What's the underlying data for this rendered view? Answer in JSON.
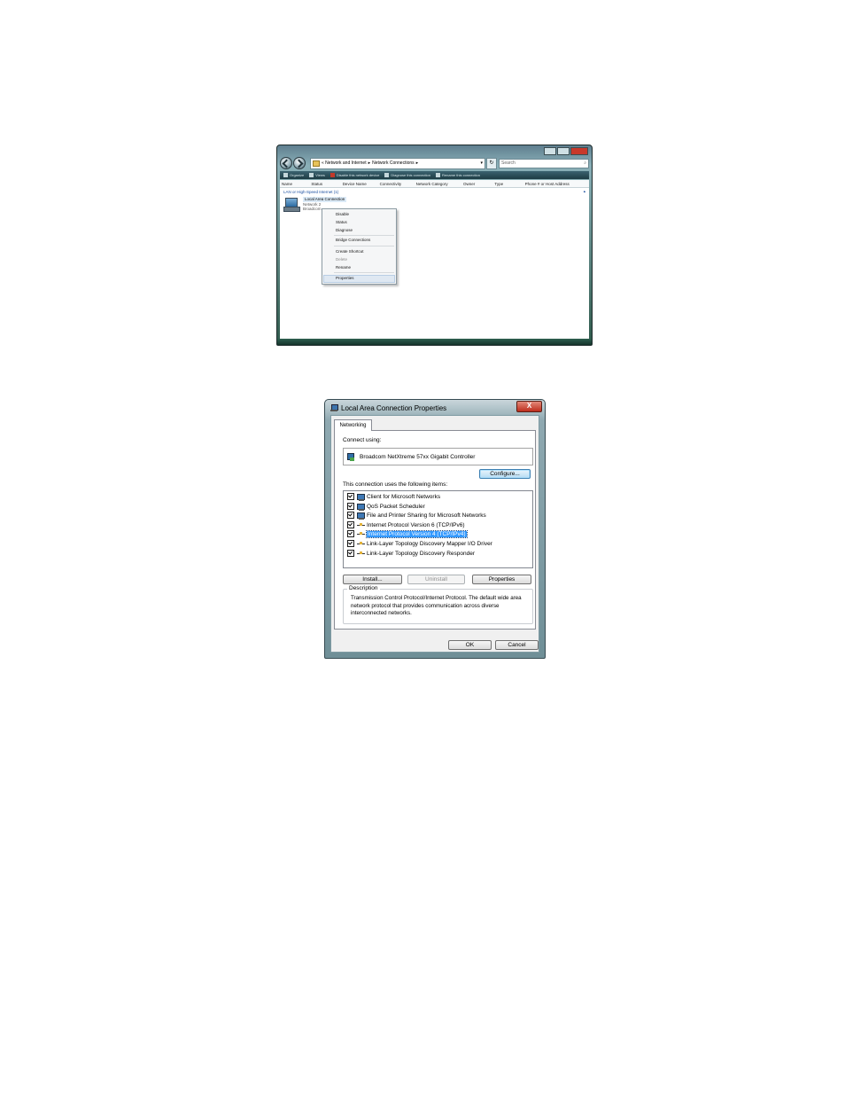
{
  "explorer": {
    "breadcrumb": [
      "Network and Internet",
      "Network Connections"
    ],
    "search_placeholder": "Search",
    "toolbar": [
      "Organize",
      "Views",
      "Disable this network device",
      "Diagnose this connection",
      "Rename this connection"
    ],
    "columns": [
      "Name",
      "Status",
      "Device Name",
      "Connectivity",
      "Network Category",
      "Owner",
      "Type",
      "Phone # or Host Address"
    ],
    "group_header": "LAN or High-Speed Internet (1)",
    "connection": {
      "name": "Local Area Connection",
      "status": "Network  2",
      "device": "Broadcom"
    },
    "context_menu": {
      "items": [
        {
          "label": "Disable",
          "disabled": false
        },
        {
          "label": "Status",
          "disabled": false
        },
        {
          "label": "Diagnose",
          "disabled": false
        },
        {
          "label": "Bridge Connections",
          "disabled": false
        },
        {
          "label": "Create Shortcut",
          "disabled": false
        },
        {
          "label": "Delete",
          "disabled": true
        },
        {
          "label": "Rename",
          "disabled": false
        },
        {
          "label": "Properties",
          "disabled": false
        }
      ]
    }
  },
  "dialog": {
    "title": "Local Area Connection Properties",
    "close_label": "X",
    "tab": "Networking",
    "connect_using_label": "Connect using:",
    "adapter": "Broadcom NetXtreme 57xx Gigabit Controller",
    "configure_button": "Configure...",
    "items_label": "This connection uses the following items:",
    "items": [
      {
        "label": "Client for Microsoft Networks",
        "checked": true,
        "icon": "network-client-icon"
      },
      {
        "label": "QoS Packet Scheduler",
        "checked": true,
        "icon": "network-client-icon"
      },
      {
        "label": "File and Printer Sharing for Microsoft Networks",
        "checked": true,
        "icon": "network-client-icon"
      },
      {
        "label": "Internet Protocol Version 6 (TCP/IPv6)",
        "checked": true,
        "icon": "protocol-icon"
      },
      {
        "label": "Internet Protocol Version 4 (TCP/IPv4)",
        "checked": true,
        "icon": "protocol-icon",
        "selected": true
      },
      {
        "label": "Link-Layer Topology Discovery Mapper I/O Driver",
        "checked": true,
        "icon": "protocol-icon"
      },
      {
        "label": "Link-Layer Topology Discovery Responder",
        "checked": true,
        "icon": "protocol-icon"
      }
    ],
    "install_button": "Install...",
    "uninstall_button": "Uninstall",
    "properties_button": "Properties",
    "description_legend": "Description",
    "description_text": "Transmission Control Protocol/Internet Protocol. The default wide area network protocol that provides communication across diverse interconnected networks.",
    "ok_button": "OK",
    "cancel_button": "Cancel"
  }
}
